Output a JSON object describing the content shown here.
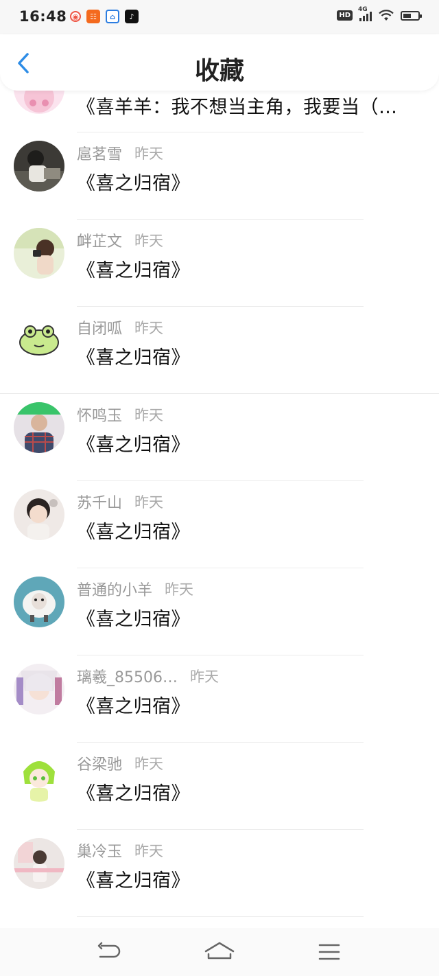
{
  "status_bar": {
    "time": "16:48",
    "network": "4G",
    "hd": "HD"
  },
  "header": {
    "title": "收藏",
    "back_icon": "chevron-left-icon",
    "accent_color": "#2d8ce6"
  },
  "favorites": [
    {
      "name": "",
      "time": "",
      "title": "《喜羊羊：我不想当主角，我要当（…"
    },
    {
      "name": "扈茗雪",
      "time": "昨天",
      "title": "《喜之归宿》"
    },
    {
      "name": "衅芷文",
      "time": "昨天",
      "title": "《喜之归宿》"
    },
    {
      "name": "自闭呱",
      "time": "昨天",
      "title": "《喜之归宿》"
    },
    {
      "name": "怀鸣玉",
      "time": "昨天",
      "title": "《喜之归宿》"
    },
    {
      "name": "苏千山",
      "time": "昨天",
      "title": "《喜之归宿》"
    },
    {
      "name": "普通的小羊",
      "time": "昨天",
      "title": "《喜之归宿》"
    },
    {
      "name": "璃羲_85506…",
      "time": "昨天",
      "title": "《喜之归宿》"
    },
    {
      "name": "谷梁驰",
      "time": "昨天",
      "title": "《喜之归宿》"
    },
    {
      "name": "巢冷玉",
      "time": "昨天",
      "title": "《喜之归宿》"
    }
  ]
}
